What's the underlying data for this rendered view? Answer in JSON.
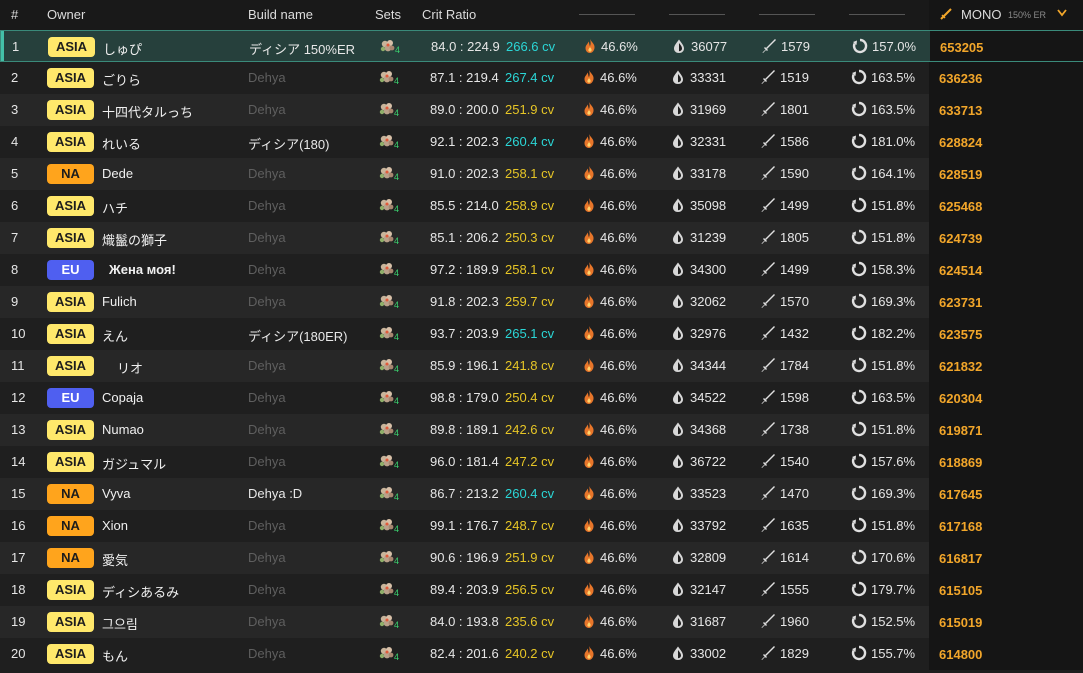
{
  "header": {
    "idx_label": "#",
    "owner_label": "Owner",
    "build_label": "Build name",
    "sets_label": "Sets",
    "crit_label": "Crit Ratio",
    "mono_label": "MONO",
    "mono_sub": "150% ER"
  },
  "colors": {
    "cv_cyan": "#2bd6d6",
    "cv_yellow": "#e6c526",
    "score": "#f2a62a",
    "asia": "#ffe86b",
    "na": "#ffa41c",
    "eu": "#4f5ff0"
  },
  "rows": [
    {
      "idx": "1",
      "region": "ASIA",
      "owner": "しゅぴ",
      "build": "ディシア 150%ER",
      "build_dim": false,
      "sets": "4",
      "ratio": "84.0 : 224.9",
      "cv": "266.6 cv",
      "cv_color": "cyan",
      "pyro": "46.6%",
      "hp": "36077",
      "atk": "1579",
      "er": "157.0%",
      "score": "653205"
    },
    {
      "idx": "2",
      "region": "ASIA",
      "owner": "ごりら",
      "build": "Dehya",
      "build_dim": true,
      "sets": "4",
      "ratio": "87.1 : 219.4",
      "cv": "267.4 cv",
      "cv_color": "cyan",
      "pyro": "46.6%",
      "hp": "33331",
      "atk": "1519",
      "er": "163.5%",
      "score": "636236"
    },
    {
      "idx": "3",
      "region": "ASIA",
      "owner": "十四代タルっち",
      "build": "Dehya",
      "build_dim": true,
      "sets": "4",
      "ratio": "89.0 : 200.0",
      "cv": "251.9 cv",
      "cv_color": "yellow",
      "pyro": "46.6%",
      "hp": "31969",
      "atk": "1801",
      "er": "163.5%",
      "score": "633713"
    },
    {
      "idx": "4",
      "region": "ASIA",
      "owner": "れいる",
      "build": "ディシア(180)",
      "build_dim": false,
      "sets": "4",
      "ratio": "92.1 : 202.3",
      "cv": "260.4 cv",
      "cv_color": "cyan",
      "pyro": "46.6%",
      "hp": "32331",
      "atk": "1586",
      "er": "181.0%",
      "score": "628824"
    },
    {
      "idx": "5",
      "region": "NA",
      "owner": "Dede",
      "build": "Dehya",
      "build_dim": true,
      "sets": "4",
      "ratio": "91.0 : 202.3",
      "cv": "258.1 cv",
      "cv_color": "yellow",
      "pyro": "46.6%",
      "hp": "33178",
      "atk": "1590",
      "er": "164.1%",
      "score": "628519"
    },
    {
      "idx": "6",
      "region": "ASIA",
      "owner": "ハチ",
      "build": "Dehya",
      "build_dim": true,
      "sets": "4",
      "ratio": "85.5 : 214.0",
      "cv": "258.9 cv",
      "cv_color": "yellow",
      "pyro": "46.6%",
      "hp": "35098",
      "atk": "1499",
      "er": "151.8%",
      "score": "625468"
    },
    {
      "idx": "7",
      "region": "ASIA",
      "owner": "熾鬣の獅子",
      "build": "Dehya",
      "build_dim": true,
      "sets": "4",
      "ratio": "85.1 : 206.2",
      "cv": "250.3 cv",
      "cv_color": "yellow",
      "pyro": "46.6%",
      "hp": "31239",
      "atk": "1805",
      "er": "151.8%",
      "score": "624739"
    },
    {
      "idx": "8",
      "region": "EU",
      "owner": "Жена моя!",
      "owner_bold": true,
      "build": "Dehya",
      "build_dim": true,
      "sets": "4",
      "ratio": "97.2 : 189.9",
      "cv": "258.1 cv",
      "cv_color": "yellow",
      "pyro": "46.6%",
      "hp": "34300",
      "atk": "1499",
      "er": "158.3%",
      "score": "624514"
    },
    {
      "idx": "9",
      "region": "ASIA",
      "owner": "Fulich",
      "build": "Dehya",
      "build_dim": true,
      "sets": "4",
      "ratio": "91.8 : 202.3",
      "cv": "259.7 cv",
      "cv_color": "yellow",
      "pyro": "46.6%",
      "hp": "32062",
      "atk": "1570",
      "er": "169.3%",
      "score": "623731"
    },
    {
      "idx": "10",
      "region": "ASIA",
      "owner": "えん",
      "build": "ディシア(180ER)",
      "build_dim": false,
      "sets": "4",
      "ratio": "93.7 : 203.9",
      "cv": "265.1 cv",
      "cv_color": "cyan",
      "pyro": "46.6%",
      "hp": "32976",
      "atk": "1432",
      "er": "182.2%",
      "score": "623575"
    },
    {
      "idx": "11",
      "region": "ASIA",
      "owner": "リオ",
      "owner_indent": true,
      "build": "Dehya",
      "build_dim": true,
      "sets": "4",
      "ratio": "85.9 : 196.1",
      "cv": "241.8 cv",
      "cv_color": "yellow",
      "pyro": "46.6%",
      "hp": "34344",
      "atk": "1784",
      "er": "151.8%",
      "score": "621832"
    },
    {
      "idx": "12",
      "region": "EU",
      "owner": "Copaja",
      "build": "Dehya",
      "build_dim": true,
      "sets": "4",
      "ratio": "98.8 : 179.0",
      "cv": "250.4 cv",
      "cv_color": "yellow",
      "pyro": "46.6%",
      "hp": "34522",
      "atk": "1598",
      "er": "163.5%",
      "score": "620304"
    },
    {
      "idx": "13",
      "region": "ASIA",
      "owner": "Numao",
      "build": "Dehya",
      "build_dim": true,
      "sets": "4",
      "ratio": "89.8 : 189.1",
      "cv": "242.6 cv",
      "cv_color": "yellow",
      "pyro": "46.6%",
      "hp": "34368",
      "atk": "1738",
      "er": "151.8%",
      "score": "619871"
    },
    {
      "idx": "14",
      "region": "ASIA",
      "owner": "ガジュマル",
      "build": "Dehya",
      "build_dim": true,
      "sets": "4",
      "ratio": "96.0 : 181.4",
      "cv": "247.2 cv",
      "cv_color": "yellow",
      "pyro": "46.6%",
      "hp": "36722",
      "atk": "1540",
      "er": "157.6%",
      "score": "618869"
    },
    {
      "idx": "15",
      "region": "NA",
      "owner": "Vyva",
      "build": "Dehya :D",
      "build_dim": false,
      "sets": "4",
      "ratio": "86.7 : 213.2",
      "cv": "260.4 cv",
      "cv_color": "cyan",
      "pyro": "46.6%",
      "hp": "33523",
      "atk": "1470",
      "er": "169.3%",
      "score": "617645"
    },
    {
      "idx": "16",
      "region": "NA",
      "owner": "Xion",
      "build": "Dehya",
      "build_dim": true,
      "sets": "4",
      "ratio": "99.1 : 176.7",
      "cv": "248.7 cv",
      "cv_color": "yellow",
      "pyro": "46.6%",
      "hp": "33792",
      "atk": "1635",
      "er": "151.8%",
      "score": "617168"
    },
    {
      "idx": "17",
      "region": "NA",
      "owner": "愛気",
      "build": "Dehya",
      "build_dim": true,
      "sets": "4",
      "ratio": "90.6 : 196.9",
      "cv": "251.9 cv",
      "cv_color": "yellow",
      "pyro": "46.6%",
      "hp": "32809",
      "atk": "1614",
      "er": "170.6%",
      "score": "616817"
    },
    {
      "idx": "18",
      "region": "ASIA",
      "owner": "ディシあるみ",
      "build": "Dehya",
      "build_dim": true,
      "sets": "4",
      "ratio": "89.4 : 203.9",
      "cv": "256.5 cv",
      "cv_color": "yellow",
      "pyro": "46.6%",
      "hp": "32147",
      "atk": "1555",
      "er": "179.7%",
      "score": "615105"
    },
    {
      "idx": "19",
      "region": "ASIA",
      "owner": "그으림",
      "build": "Dehya",
      "build_dim": true,
      "sets": "4",
      "ratio": "84.0 : 193.8",
      "cv": "235.6 cv",
      "cv_color": "yellow",
      "pyro": "46.6%",
      "hp": "31687",
      "atk": "1960",
      "er": "152.5%",
      "score": "615019"
    },
    {
      "idx": "20",
      "region": "ASIA",
      "owner": "もん",
      "build": "Dehya",
      "build_dim": true,
      "sets": "4",
      "ratio": "82.4 : 201.6",
      "cv": "240.2 cv",
      "cv_color": "yellow",
      "pyro": "46.6%",
      "hp": "33002",
      "atk": "1829",
      "er": "155.7%",
      "score": "614800"
    }
  ]
}
